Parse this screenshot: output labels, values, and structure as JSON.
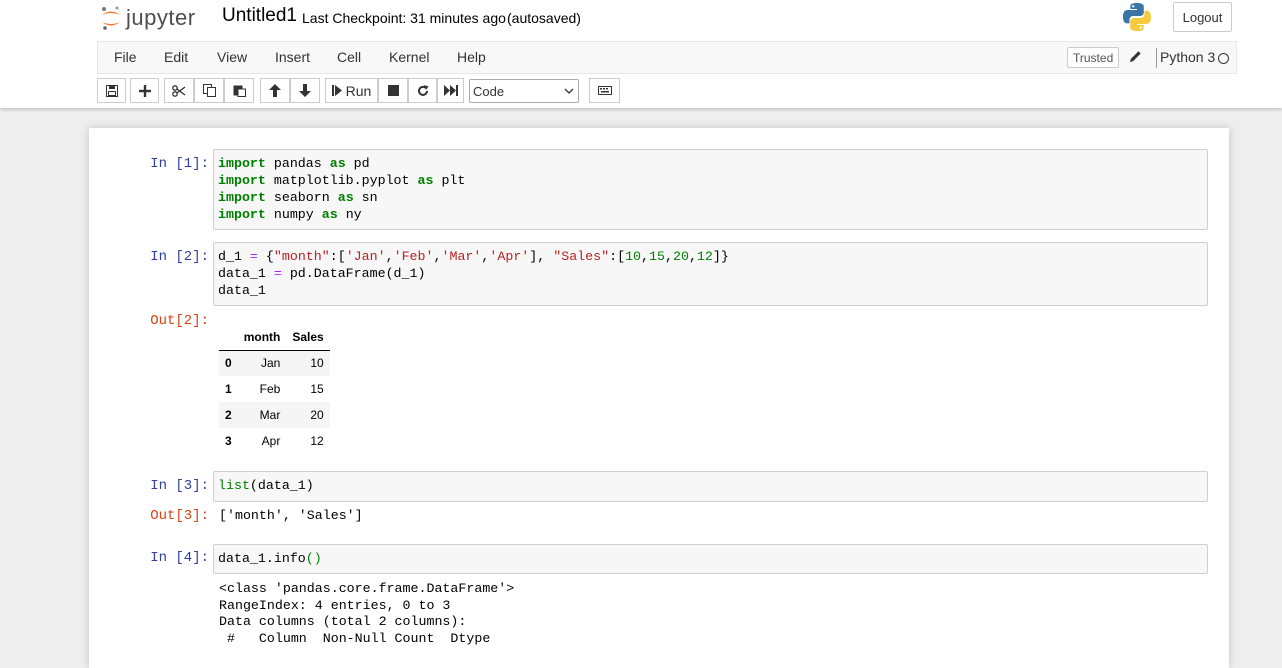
{
  "header": {
    "logo_text": "jupyter",
    "notebook_name": "Untitled1",
    "checkpoint": "Last Checkpoint: 31 minutes ago",
    "autosave": "(autosaved)",
    "logout_label": "Logout"
  },
  "menu": {
    "items": [
      "File",
      "Edit",
      "View",
      "Insert",
      "Cell",
      "Kernel",
      "Help"
    ],
    "trusted_label": "Trusted",
    "kernel_name": "Python 3"
  },
  "toolbar": {
    "run_label": "Run",
    "cell_type": "Code"
  },
  "cells": {
    "c1": {
      "prompt": "In [1]:"
    },
    "c2": {
      "prompt": "In [2]:",
      "out_prompt": "Out[2]:"
    },
    "c3": {
      "prompt": "In [3]:",
      "out_prompt": "Out[3]:",
      "output": "['month', 'Sales']"
    },
    "c4": {
      "prompt": "In [4]:",
      "output_lines": [
        "<class 'pandas.core.frame.DataFrame'>",
        "RangeIndex: 4 entries, 0 to 3",
        "Data columns (total 2 columns):",
        " #   Column  Non-Null Count  Dtype"
      ]
    }
  },
  "dataframe": {
    "columns": [
      "month",
      "Sales"
    ],
    "rows": [
      {
        "index": "0",
        "month": "Jan",
        "sales": "10"
      },
      {
        "index": "1",
        "month": "Feb",
        "sales": "15"
      },
      {
        "index": "2",
        "month": "Mar",
        "sales": "20"
      },
      {
        "index": "3",
        "month": "Apr",
        "sales": "12"
      }
    ]
  },
  "colors": {
    "in_prompt": "#303f9f",
    "out_prompt": "#d84315",
    "keyword": "#008000",
    "string": "#ba2121"
  }
}
